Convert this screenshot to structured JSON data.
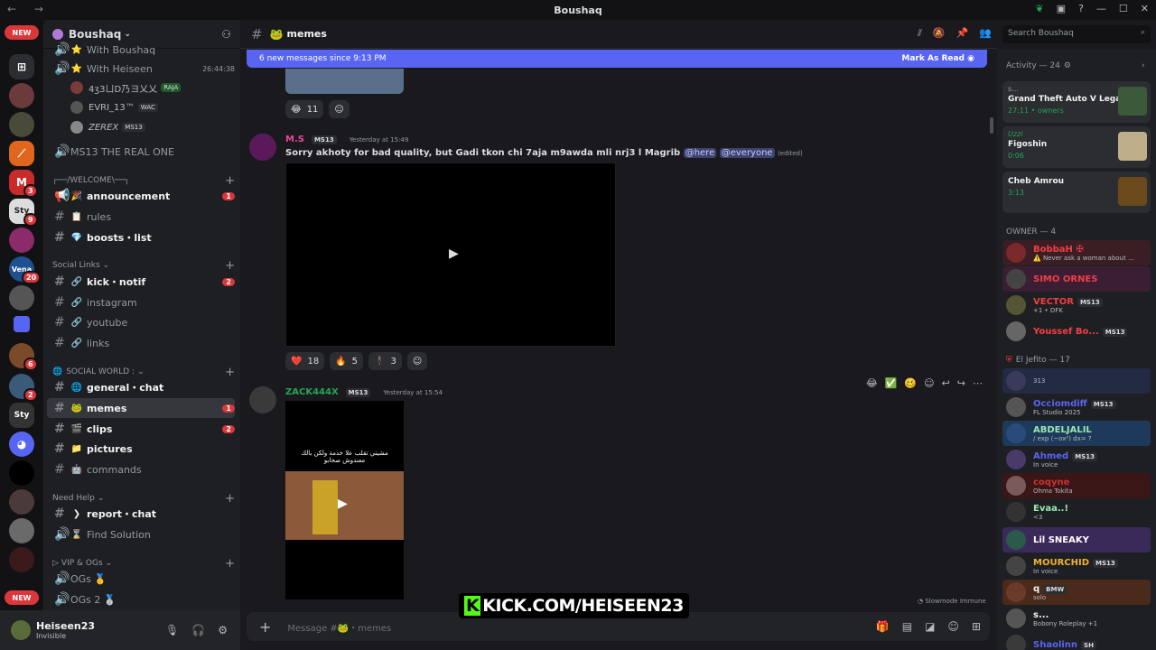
{
  "app": {
    "title": "Boushaq"
  },
  "server": {
    "name": "Boushaq"
  },
  "rail": {
    "new_top": "NEW",
    "new_bottom": "NEW",
    "badges": {
      "m": "3",
      "styles": "9",
      "vena": "20",
      "srv10": "6",
      "srv11": "2"
    }
  },
  "sidebar": {
    "voice_items": [
      {
        "label": "With Boushaq"
      },
      {
        "label": "With Heiseen",
        "timer": "26:44:38"
      }
    ],
    "voice_users": [
      {
        "name": "4ʒ3ㄩD乃ヨ乂乂",
        "tag": "RAJA"
      },
      {
        "name": "EVRI_13™",
        "tag": "WAC"
      },
      {
        "name": "ZEREX",
        "tag": "MS13"
      }
    ],
    "ms13_voice": "MS13 THE REAL ONE",
    "cat_welcome": "┌──/WELCOME\\──┐",
    "welcome_channels": [
      {
        "label": "announcement",
        "emoji": "🎉",
        "count": "1"
      },
      {
        "label": "rules",
        "emoji": "📋"
      },
      {
        "label": "boosts・list",
        "emoji": "💎"
      }
    ],
    "cat_social": "Social Links",
    "social_channels": [
      {
        "label": "kick・notif",
        "count": "2"
      },
      {
        "label": "instagram"
      },
      {
        "label": "youtube"
      },
      {
        "label": "links"
      }
    ],
    "cat_world": "SOCIAL WORLD :",
    "world_channels": [
      {
        "label": "general・chat",
        "emoji": "🌐"
      },
      {
        "label": "memes",
        "emoji": "🐸",
        "count": "1"
      },
      {
        "label": "clips",
        "emoji": "🎬",
        "count": "2"
      },
      {
        "label": "pictures",
        "emoji": "📁"
      },
      {
        "label": "commands",
        "emoji": "🤖"
      }
    ],
    "cat_help": "Need Help",
    "help_channels": [
      {
        "label": "report・chat",
        "emoji": "❯"
      },
      {
        "label": "Find Solution",
        "emoji": "⌛"
      }
    ],
    "cat_vip": "VIP & OGs",
    "vip_channels": [
      {
        "label": "OGs 🥇"
      },
      {
        "label": "OGs 2 🥈"
      }
    ]
  },
  "user": {
    "name": "Heiseen23",
    "status": "Invisible"
  },
  "chat": {
    "channel": "memes",
    "new_messages": "6 new messages since 9:13 PM",
    "mark_read": "Mark As Read",
    "search_placeholder": "Search Boushaq",
    "reactions_top": [
      {
        "emoji": "😂",
        "count": "11"
      }
    ],
    "msg1": {
      "author": "M.S",
      "tag": "MS13",
      "time": "Yesterday at 15:49",
      "text": "Sorry akhoty  for bad quality, but Gadi tkon chi 7aja m9awda mli nrj3 l Magrib",
      "mention1": "@here",
      "mention2": "@everyone",
      "edited": "(edited)"
    },
    "reactions_msg1": [
      {
        "emoji": "❤️",
        "count": "18"
      },
      {
        "emoji": "🔥",
        "count": "5"
      },
      {
        "emoji": "🕴",
        "count": "3"
      }
    ],
    "msg2": {
      "author": "ZACK444X",
      "tag": "MS13",
      "time": "Yesterday at 15:54",
      "video_text": "مشيتي تقلب علا خدمة ولكن بالك معندوش صحابو"
    },
    "composer_placeholder": "Message #🐸・memes",
    "slowmode": "Slowmode Immune",
    "overlay": "KICK.COM/HEISEEN23"
  },
  "members": {
    "activity_header": "Activity — 24",
    "activities": [
      {
        "user": "s...",
        "title": "Grand Theft Auto V Legacy",
        "meta": "27:11 • owners"
      },
      {
        "user": "Uzzi",
        "title": "Figoshin",
        "meta": "0:06"
      },
      {
        "user": "",
        "title": "Cheb Amrou",
        "meta": "3:13"
      }
    ],
    "owner_header": "OWNER — 4",
    "owners": [
      {
        "name": "BobbaH ✠",
        "sub": "⚠️ Never ask a woman about ...",
        "color": "#f23f43"
      },
      {
        "name": "SIMO ORNES",
        "sub": "",
        "color": "#f23f43"
      },
      {
        "name": "VECTOR",
        "tag": "MS13",
        "sub": "+1 • DFK",
        "color": "#f23f43"
      },
      {
        "name": "Youssef Bo...",
        "tag": "MS13",
        "sub": "",
        "color": "#f23f43"
      }
    ],
    "jefito_header": "El Jefito — 17",
    "jefitos": [
      {
        "name": "",
        "sub": "313",
        "color": "#5865f2"
      },
      {
        "name": "Occiomdiff",
        "tag": "MS13",
        "sub": "FL Studio 2025",
        "color": "#5865f2"
      },
      {
        "name": "ABDELJALIL",
        "sub": "/ exp (~ox²) dx= ?",
        "color": "#f2f3f5"
      },
      {
        "name": "Ahmed",
        "tag": "MS13",
        "sub": "In voice",
        "color": "#5865f2"
      },
      {
        "name": "coqyne",
        "sub": "Ohma Tokita",
        "color": "#c33"
      },
      {
        "name": "Evaa..!",
        "sub": "<3",
        "color": "#9ae6b4"
      },
      {
        "name": "Lil SNEAKY",
        "sub": "",
        "color": "#fff"
      },
      {
        "name": "MOURCHID",
        "tag": "MS13",
        "sub": "In voice",
        "color": "#f0b232"
      },
      {
        "name": "q",
        "tag": "BMW",
        "sub": "solo",
        "color": "#f2f3f5"
      },
      {
        "name": "s...",
        "sub": "Bobony Roleplay +1",
        "color": "#f2f3f5"
      },
      {
        "name": "Shaolinn",
        "tag": "SH",
        "sub": "",
        "color": "#5865f2"
      }
    ]
  }
}
